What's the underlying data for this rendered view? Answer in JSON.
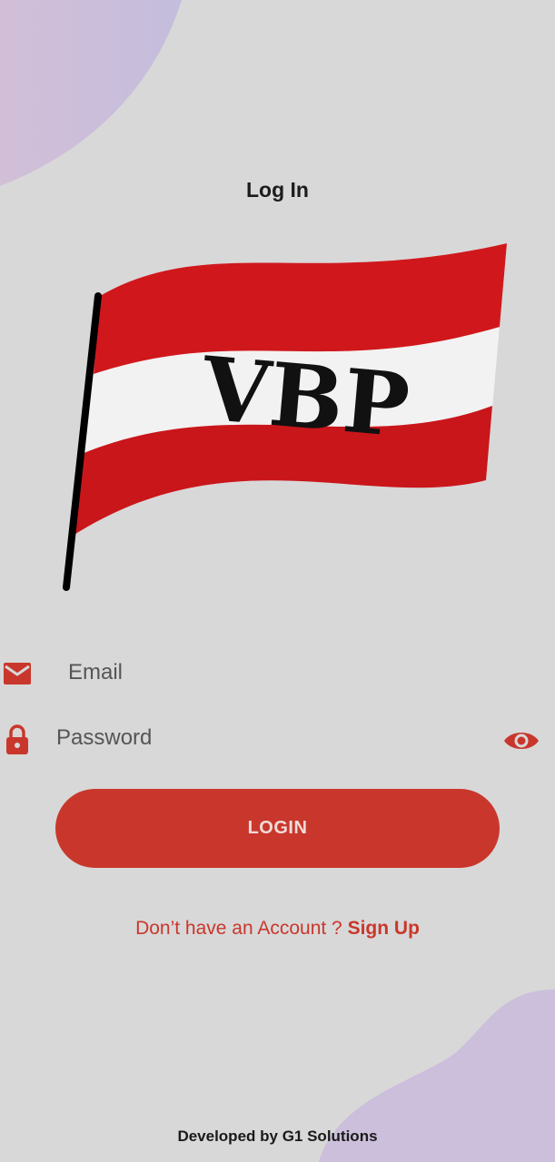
{
  "header": {
    "title": "Log In"
  },
  "logo": {
    "text": "VBP",
    "flag_red": "#d0181c",
    "flag_white": "#f2f2f2",
    "pole_color": "#000000"
  },
  "form": {
    "email_placeholder": "Email",
    "email_icon": "mail-icon",
    "password_placeholder": "Password",
    "password_icon": "lock-icon",
    "toggle_icon": "eye-icon",
    "login_label": "LOGIN"
  },
  "signup": {
    "prompt": "Don’t have an Account ?",
    "link_label": "Sign Up"
  },
  "footer": {
    "credit": "Developed by G1 Solutions"
  },
  "colors": {
    "background": "#d8d8d8",
    "accent": "#c9372c",
    "blob": "#cbbfdb"
  }
}
